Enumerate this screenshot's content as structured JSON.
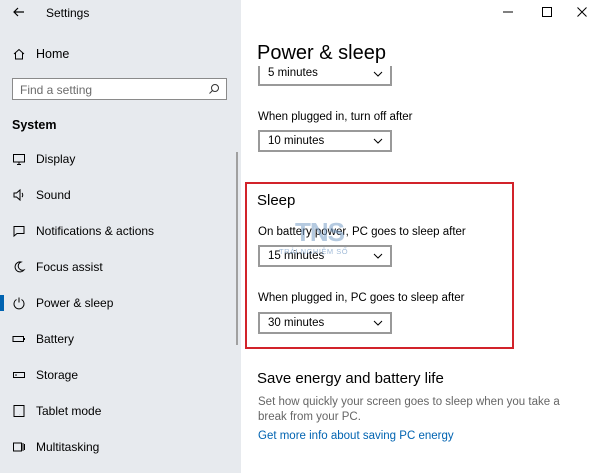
{
  "window": {
    "title": "Settings",
    "controls": {
      "minimize": "minimize-icon",
      "maximize": "maximize-icon",
      "close": "close-icon"
    }
  },
  "sidebar": {
    "home_label": "Home",
    "search": {
      "placeholder": "Find a setting",
      "value": ""
    },
    "section": "System",
    "items": [
      {
        "label": "Display",
        "icon": "display-icon",
        "active": false
      },
      {
        "label": "Sound",
        "icon": "sound-icon",
        "active": false
      },
      {
        "label": "Notifications & actions",
        "icon": "notifications-icon",
        "active": false
      },
      {
        "label": "Focus assist",
        "icon": "focus-assist-icon",
        "active": false
      },
      {
        "label": "Power & sleep",
        "icon": "power-icon",
        "active": true
      },
      {
        "label": "Battery",
        "icon": "battery-icon",
        "active": false
      },
      {
        "label": "Storage",
        "icon": "storage-icon",
        "active": false
      },
      {
        "label": "Tablet mode",
        "icon": "tablet-mode-icon",
        "active": false
      },
      {
        "label": "Multitasking",
        "icon": "multitasking-icon",
        "active": false
      }
    ]
  },
  "main": {
    "title": "Power & sleep",
    "screen": {
      "battery_value": "5 minutes",
      "plugged_label": "When plugged in, turn off after",
      "plugged_value": "10 minutes"
    },
    "sleep": {
      "header": "Sleep",
      "battery_label": "On battery power, PC goes to sleep after",
      "battery_value": "15 minutes",
      "plugged_label": "When plugged in, PC goes to sleep after",
      "plugged_value": "30 minutes"
    },
    "save_energy": {
      "header": "Save energy and battery life",
      "description": "Set how quickly your screen goes to sleep when you take a break from your PC.",
      "link": "Get more info about saving PC energy"
    },
    "watermark": {
      "big": "TNS",
      "small": "TRẢI NGHIỆM SỐ"
    }
  },
  "colors": {
    "accent": "#0063b1",
    "highlight": "#d2232a",
    "sidebar_bg": "#e7eaee"
  }
}
